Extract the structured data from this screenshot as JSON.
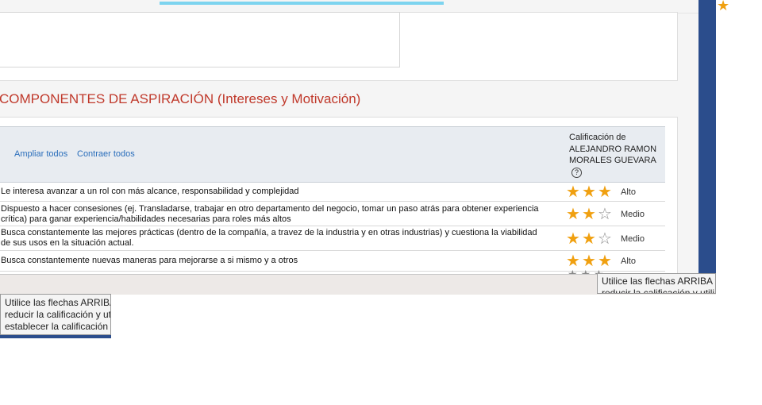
{
  "section": {
    "title": "COMPONENTES DE ASPIRACIÓN (Intereses y Motivación)"
  },
  "header": {
    "expand_all": "Ampliar todos",
    "collapse_all": "Contraer todos",
    "rating_label": "Calificación de ALEJANDRO RAMON MORALES GUEVARA",
    "help_glyph": "?"
  },
  "rows": [
    {
      "text": "Le interesa avanzar a un rol con más alcance, responsabilidad y complejidad",
      "stars": 3,
      "level": "Alto"
    },
    {
      "text": "Dispuesto a hacer consesiones (ej. Transladarse, trabajar en otro departamento del negocio, tomar un paso atrás para obtener experiencia crítica) para ganar experiencia/habilidades necesarias para roles más altos",
      "stars": 2,
      "level": "Medio"
    },
    {
      "text": "Busca constantemente las mejores prácticas (dentro de la compañía, a travez de la industria y en otras industrias) y cuestiona la viabilidad de sus usos en la situación actual.",
      "stars": 2,
      "level": "Medio"
    },
    {
      "text": "Busca constantemente nuevas maneras para mejorarse a si mismo y a otros",
      "stars": 3,
      "level": "Alto"
    }
  ],
  "tooltips": {
    "left": [
      "Utilice las flechas ARRIBA",
      "reducir la calificación y ut",
      "establecer la calificación r"
    ],
    "right": [
      "Utilice las flechas ARRIBA y",
      "reducir la calificación y utili"
    ]
  },
  "colors": {
    "accent": "#c0392b",
    "link": "#2a6ebb",
    "star_on": "#f0a010",
    "star_off": "#8a8a8a"
  },
  "icons": {
    "star_filled": "★",
    "star_empty": "☆",
    "scroll_down": "chevron-down-icon",
    "help": "help-circle-icon"
  }
}
